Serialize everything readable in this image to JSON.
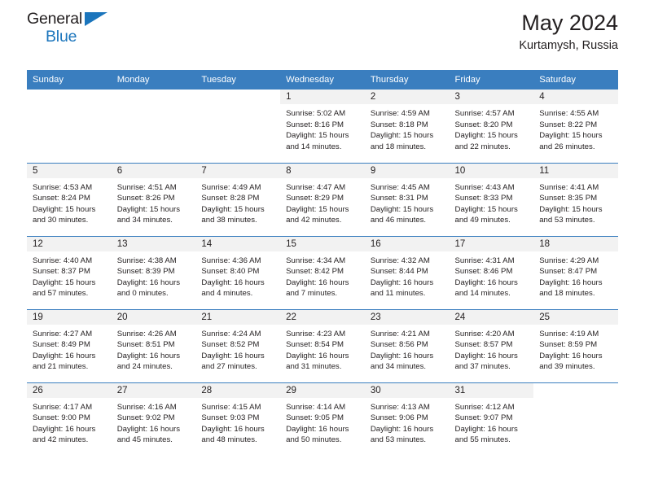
{
  "brand": {
    "name_top": "General",
    "name_bottom": "Blue",
    "triangle_color": "#1b75bc",
    "text_color": "#231f20"
  },
  "header": {
    "title": "May 2024",
    "subtitle": "Kurtamysh, Russia"
  },
  "theme": {
    "header_bg": "#3a7ebf",
    "header_text": "#ffffff",
    "daynum_bg": "#f2f2f2",
    "row_separator": "#3a7ebf",
    "body_text": "#231f20"
  },
  "weekdays": [
    "Sunday",
    "Monday",
    "Tuesday",
    "Wednesday",
    "Thursday",
    "Friday",
    "Saturday"
  ],
  "labels": {
    "sunrise_prefix": "Sunrise:",
    "sunset_prefix": "Sunset:",
    "daylight_prefix": "Daylight:"
  },
  "weeks": [
    [
      {
        "day": "",
        "empty": true,
        "l1": "",
        "l2": "",
        "l3": "",
        "l4": ""
      },
      {
        "day": "",
        "empty": true,
        "l1": "",
        "l2": "",
        "l3": "",
        "l4": ""
      },
      {
        "day": "",
        "empty": true,
        "l1": "",
        "l2": "",
        "l3": "",
        "l4": ""
      },
      {
        "day": "1",
        "empty": false,
        "l1": "Sunrise: 5:02 AM",
        "l2": "Sunset: 8:16 PM",
        "l3": "Daylight: 15 hours",
        "l4": "and 14 minutes."
      },
      {
        "day": "2",
        "empty": false,
        "l1": "Sunrise: 4:59 AM",
        "l2": "Sunset: 8:18 PM",
        "l3": "Daylight: 15 hours",
        "l4": "and 18 minutes."
      },
      {
        "day": "3",
        "empty": false,
        "l1": "Sunrise: 4:57 AM",
        "l2": "Sunset: 8:20 PM",
        "l3": "Daylight: 15 hours",
        "l4": "and 22 minutes."
      },
      {
        "day": "4",
        "empty": false,
        "l1": "Sunrise: 4:55 AM",
        "l2": "Sunset: 8:22 PM",
        "l3": "Daylight: 15 hours",
        "l4": "and 26 minutes."
      }
    ],
    [
      {
        "day": "5",
        "empty": false,
        "l1": "Sunrise: 4:53 AM",
        "l2": "Sunset: 8:24 PM",
        "l3": "Daylight: 15 hours",
        "l4": "and 30 minutes."
      },
      {
        "day": "6",
        "empty": false,
        "l1": "Sunrise: 4:51 AM",
        "l2": "Sunset: 8:26 PM",
        "l3": "Daylight: 15 hours",
        "l4": "and 34 minutes."
      },
      {
        "day": "7",
        "empty": false,
        "l1": "Sunrise: 4:49 AM",
        "l2": "Sunset: 8:28 PM",
        "l3": "Daylight: 15 hours",
        "l4": "and 38 minutes."
      },
      {
        "day": "8",
        "empty": false,
        "l1": "Sunrise: 4:47 AM",
        "l2": "Sunset: 8:29 PM",
        "l3": "Daylight: 15 hours",
        "l4": "and 42 minutes."
      },
      {
        "day": "9",
        "empty": false,
        "l1": "Sunrise: 4:45 AM",
        "l2": "Sunset: 8:31 PM",
        "l3": "Daylight: 15 hours",
        "l4": "and 46 minutes."
      },
      {
        "day": "10",
        "empty": false,
        "l1": "Sunrise: 4:43 AM",
        "l2": "Sunset: 8:33 PM",
        "l3": "Daylight: 15 hours",
        "l4": "and 49 minutes."
      },
      {
        "day": "11",
        "empty": false,
        "l1": "Sunrise: 4:41 AM",
        "l2": "Sunset: 8:35 PM",
        "l3": "Daylight: 15 hours",
        "l4": "and 53 minutes."
      }
    ],
    [
      {
        "day": "12",
        "empty": false,
        "l1": "Sunrise: 4:40 AM",
        "l2": "Sunset: 8:37 PM",
        "l3": "Daylight: 15 hours",
        "l4": "and 57 minutes."
      },
      {
        "day": "13",
        "empty": false,
        "l1": "Sunrise: 4:38 AM",
        "l2": "Sunset: 8:39 PM",
        "l3": "Daylight: 16 hours",
        "l4": "and 0 minutes."
      },
      {
        "day": "14",
        "empty": false,
        "l1": "Sunrise: 4:36 AM",
        "l2": "Sunset: 8:40 PM",
        "l3": "Daylight: 16 hours",
        "l4": "and 4 minutes."
      },
      {
        "day": "15",
        "empty": false,
        "l1": "Sunrise: 4:34 AM",
        "l2": "Sunset: 8:42 PM",
        "l3": "Daylight: 16 hours",
        "l4": "and 7 minutes."
      },
      {
        "day": "16",
        "empty": false,
        "l1": "Sunrise: 4:32 AM",
        "l2": "Sunset: 8:44 PM",
        "l3": "Daylight: 16 hours",
        "l4": "and 11 minutes."
      },
      {
        "day": "17",
        "empty": false,
        "l1": "Sunrise: 4:31 AM",
        "l2": "Sunset: 8:46 PM",
        "l3": "Daylight: 16 hours",
        "l4": "and 14 minutes."
      },
      {
        "day": "18",
        "empty": false,
        "l1": "Sunrise: 4:29 AM",
        "l2": "Sunset: 8:47 PM",
        "l3": "Daylight: 16 hours",
        "l4": "and 18 minutes."
      }
    ],
    [
      {
        "day": "19",
        "empty": false,
        "l1": "Sunrise: 4:27 AM",
        "l2": "Sunset: 8:49 PM",
        "l3": "Daylight: 16 hours",
        "l4": "and 21 minutes."
      },
      {
        "day": "20",
        "empty": false,
        "l1": "Sunrise: 4:26 AM",
        "l2": "Sunset: 8:51 PM",
        "l3": "Daylight: 16 hours",
        "l4": "and 24 minutes."
      },
      {
        "day": "21",
        "empty": false,
        "l1": "Sunrise: 4:24 AM",
        "l2": "Sunset: 8:52 PM",
        "l3": "Daylight: 16 hours",
        "l4": "and 27 minutes."
      },
      {
        "day": "22",
        "empty": false,
        "l1": "Sunrise: 4:23 AM",
        "l2": "Sunset: 8:54 PM",
        "l3": "Daylight: 16 hours",
        "l4": "and 31 minutes."
      },
      {
        "day": "23",
        "empty": false,
        "l1": "Sunrise: 4:21 AM",
        "l2": "Sunset: 8:56 PM",
        "l3": "Daylight: 16 hours",
        "l4": "and 34 minutes."
      },
      {
        "day": "24",
        "empty": false,
        "l1": "Sunrise: 4:20 AM",
        "l2": "Sunset: 8:57 PM",
        "l3": "Daylight: 16 hours",
        "l4": "and 37 minutes."
      },
      {
        "day": "25",
        "empty": false,
        "l1": "Sunrise: 4:19 AM",
        "l2": "Sunset: 8:59 PM",
        "l3": "Daylight: 16 hours",
        "l4": "and 39 minutes."
      }
    ],
    [
      {
        "day": "26",
        "empty": false,
        "l1": "Sunrise: 4:17 AM",
        "l2": "Sunset: 9:00 PM",
        "l3": "Daylight: 16 hours",
        "l4": "and 42 minutes."
      },
      {
        "day": "27",
        "empty": false,
        "l1": "Sunrise: 4:16 AM",
        "l2": "Sunset: 9:02 PM",
        "l3": "Daylight: 16 hours",
        "l4": "and 45 minutes."
      },
      {
        "day": "28",
        "empty": false,
        "l1": "Sunrise: 4:15 AM",
        "l2": "Sunset: 9:03 PM",
        "l3": "Daylight: 16 hours",
        "l4": "and 48 minutes."
      },
      {
        "day": "29",
        "empty": false,
        "l1": "Sunrise: 4:14 AM",
        "l2": "Sunset: 9:05 PM",
        "l3": "Daylight: 16 hours",
        "l4": "and 50 minutes."
      },
      {
        "day": "30",
        "empty": false,
        "l1": "Sunrise: 4:13 AM",
        "l2": "Sunset: 9:06 PM",
        "l3": "Daylight: 16 hours",
        "l4": "and 53 minutes."
      },
      {
        "day": "31",
        "empty": false,
        "l1": "Sunrise: 4:12 AM",
        "l2": "Sunset: 9:07 PM",
        "l3": "Daylight: 16 hours",
        "l4": "and 55 minutes."
      },
      {
        "day": "",
        "empty": true,
        "l1": "",
        "l2": "",
        "l3": "",
        "l4": ""
      }
    ]
  ]
}
